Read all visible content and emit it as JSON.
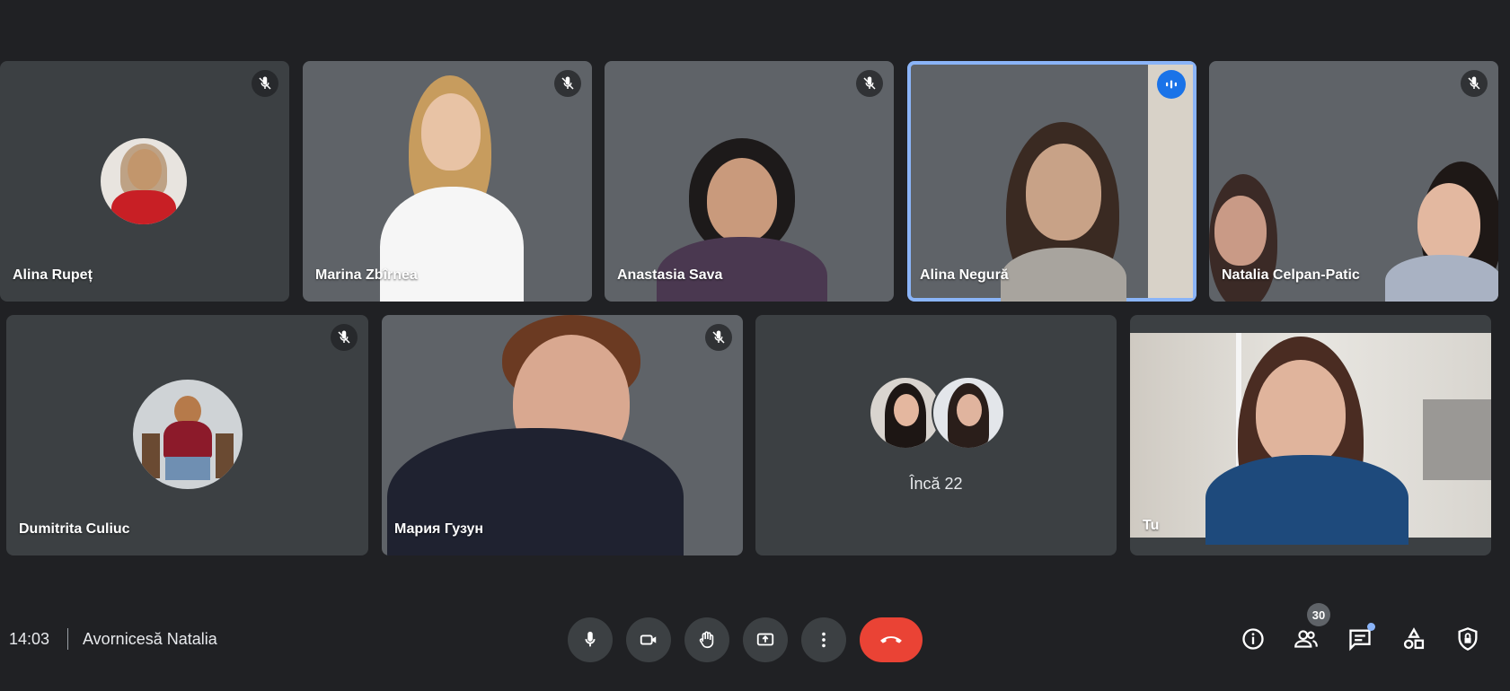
{
  "participants_row1": [
    {
      "name": "Alina Rupeț",
      "muted": true
    },
    {
      "name": "Marina Zbîrnea",
      "muted": true
    },
    {
      "name": "Anastasia Sava",
      "muted": true
    },
    {
      "name": "Alina Negură",
      "speaking": true
    },
    {
      "name": "Natalia Celpan-Patic",
      "muted": true
    }
  ],
  "participants_row2": [
    {
      "name": "Dumitrita Culiuc",
      "muted": true
    },
    {
      "name": "Мария Гузун",
      "muted": true
    },
    {
      "name": "Încă 22"
    },
    {
      "name": "Tu"
    }
  ],
  "bottom_bar": {
    "time": "14:03",
    "meeting_name": "Avornicesă Natalia",
    "participant_count": "30"
  },
  "icons": {
    "mic": "microphone-icon",
    "camera": "camera-icon",
    "hand": "raise-hand-icon",
    "present": "present-screen-icon",
    "more": "more-options-icon",
    "end": "end-call-icon",
    "info": "info-icon",
    "people": "people-icon",
    "chat": "chat-icon",
    "activities": "activities-icon",
    "security": "host-controls-icon"
  },
  "colors": {
    "background": "#202124",
    "tile": "#3c4043",
    "end_call": "#ea4335",
    "speaking": "#1a73e8",
    "active_border": "#8ab4f8"
  }
}
